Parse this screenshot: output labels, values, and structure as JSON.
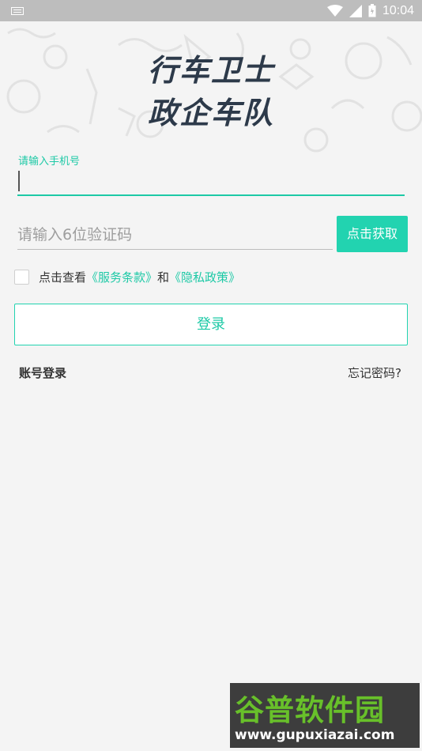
{
  "status_bar": {
    "time": "10:04"
  },
  "header": {
    "title_line1": "行车卫士",
    "title_line2": "政企车队"
  },
  "phone": {
    "label": "请输入手机号",
    "value": ""
  },
  "code": {
    "placeholder": "请输入6位验证码",
    "button_label": "点击获取"
  },
  "agreement": {
    "prefix": "点击查看",
    "terms_link": "《服务条款》",
    "conjunction": "和",
    "privacy_link": "《隐私政策》"
  },
  "login_button": "登录",
  "footer": {
    "account_login": "账号登录",
    "forgot_password": "忘记密码?"
  },
  "watermark": {
    "name": "谷普软件园",
    "url": "www.gupuxiazai.com"
  },
  "colors": {
    "accent": "#22d3b0",
    "title": "#2d3a4a",
    "background": "#f4f4f4"
  }
}
